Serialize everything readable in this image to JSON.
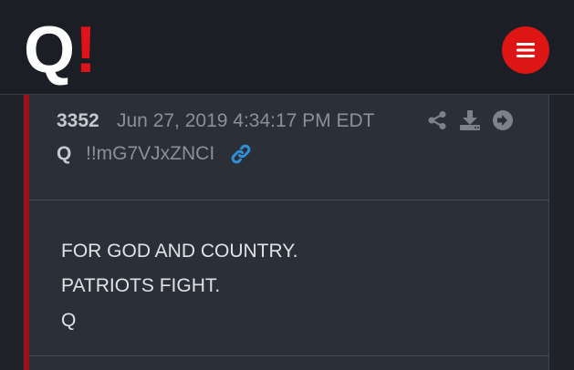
{
  "header": {
    "logo_letter": "Q",
    "logo_mark": "!",
    "menu_icon": "hamburger-menu-icon",
    "brand_color": "#dd1515"
  },
  "post": {
    "number": "3352",
    "date": "Jun 27, 2019 4:34:17 PM EDT",
    "author": "Q",
    "tripcode": "!!mG7VJxZNCI",
    "actions": [
      {
        "icon": "share-icon"
      },
      {
        "icon": "download-icon"
      },
      {
        "icon": "arrow-right-circle-icon"
      }
    ],
    "link_icon": "link-icon",
    "accent_color": "#9b1218",
    "link_color": "#2f8fd6",
    "body": {
      "line1": "FOR GOD AND COUNTRY.",
      "line2": "PATRIOTS FIGHT.",
      "line3": "Q"
    }
  }
}
